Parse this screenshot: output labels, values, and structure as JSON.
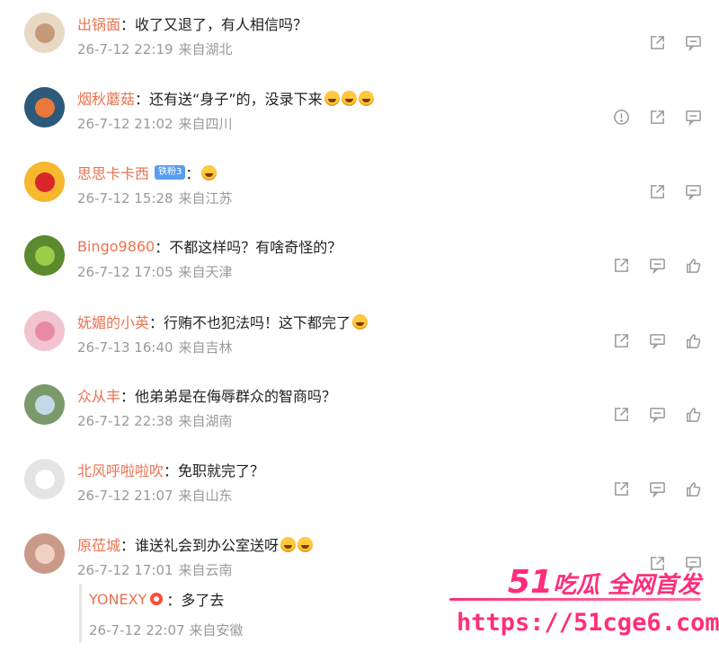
{
  "comments": [
    {
      "user": "出锅面",
      "text": "收了又退了，有人相信吗？",
      "time": "26-7-12 22:19",
      "location": "来自湖北",
      "emojis": 0,
      "badge": "",
      "actions": [
        "share-icon",
        "comment-icon"
      ],
      "avatar_color": "#e8d9c4",
      "avatar_inner": "#c49a78"
    },
    {
      "user": "烟秋蘑菇",
      "text": "还有送“身子”的，没录下来",
      "time": "26-7-12 21:02",
      "location": "来自四川",
      "emojis": 3,
      "badge": "",
      "actions": [
        "report-icon",
        "share-icon",
        "comment-icon"
      ],
      "avatar_color": "#2d5a7a",
      "avatar_inner": "#e8793a"
    },
    {
      "user": "思思卡卡西",
      "text": "：",
      "time": "26-7-12 15:28",
      "location": "来自江苏",
      "emojis": 1,
      "badge": "铁粉3",
      "actions": [
        "share-icon",
        "comment-icon"
      ],
      "avatar_color": "#f5b82e",
      "avatar_inner": "#d8262b"
    },
    {
      "user": "Bingo9860",
      "text": "不都这样吗？有啥奇怪的？",
      "time": "26-7-12 17:05",
      "location": "来自天津",
      "emojis": 0,
      "badge": "",
      "actions": [
        "share-icon",
        "comment-icon",
        "like-icon"
      ],
      "avatar_color": "#5c8a2e",
      "avatar_inner": "#9ccc4a"
    },
    {
      "user": "妩媚的小英",
      "text": "行贿不也犯法吗！这下都完了",
      "time": "26-7-13 16:40",
      "location": "来自吉林",
      "emojis": 1,
      "badge": "",
      "actions": [
        "share-icon",
        "comment-icon",
        "like-icon"
      ],
      "avatar_color": "#f2c4d0",
      "avatar_inner": "#e88aa8"
    },
    {
      "user": "众从丰",
      "text": "他弟弟是在侮辱群众的智商吗？",
      "time": "26-7-12 22:38",
      "location": "来自湖南",
      "emojis": 0,
      "badge": "",
      "actions": [
        "share-icon",
        "comment-icon",
        "like-icon"
      ],
      "avatar_color": "#7a9a6a",
      "avatar_inner": "#c4d8e8"
    },
    {
      "user": "北风呼啦啦吹",
      "text": "免职就完了？",
      "time": "26-7-12 21:07",
      "location": "来自山东",
      "emojis": 0,
      "badge": "",
      "actions": [
        "share-icon",
        "comment-icon",
        "like-icon"
      ],
      "avatar_color": "#e4e4e4",
      "avatar_inner": "#ffffff"
    },
    {
      "user": "原莅城",
      "text": "谁送礼会到办公室送呀",
      "time": "26-7-12 17:01",
      "location": "来自云南",
      "emojis": 2,
      "badge": "",
      "actions": [
        "share-icon",
        "comment-icon"
      ],
      "avatar_color": "#c99a8a",
      "avatar_inner": "#f1d2c2"
    }
  ],
  "reply": {
    "user": "YONEXY",
    "text": "多了去",
    "time": "26-7-12 22:07",
    "location": "来自安徽"
  },
  "watermark": {
    "brand_num": "51",
    "brand_text": "吃瓜 全网首发",
    "url": "https://51cge6.com"
  },
  "colors": {
    "username": "#eb7350",
    "meta": "#9a9a9a",
    "watermark": "#ff2e7a"
  }
}
